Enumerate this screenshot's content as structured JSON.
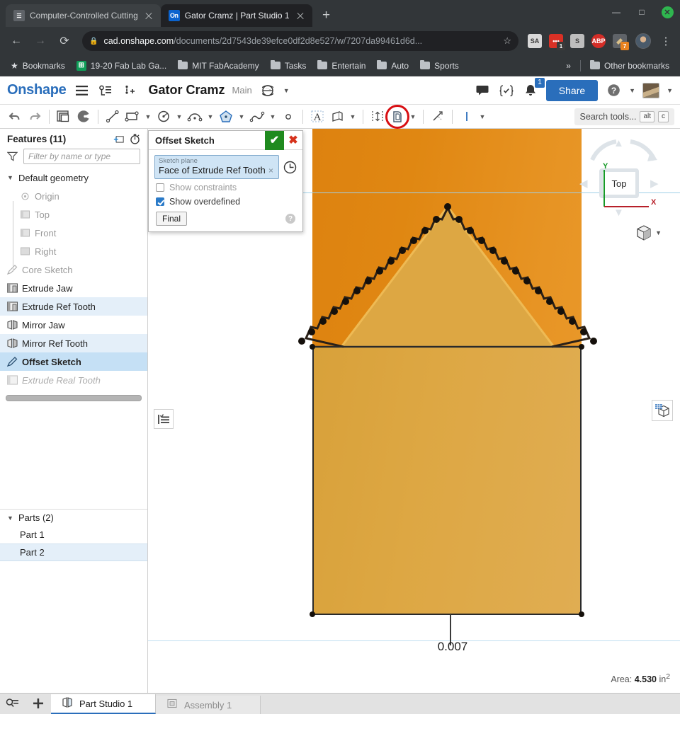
{
  "browser": {
    "tabs": [
      {
        "title": "Computer-Controlled Cutting",
        "favicon": "page-icon",
        "active": false
      },
      {
        "title": "Gator Cramz | Part Studio 1",
        "favicon": "onshape-icon",
        "active": true
      }
    ],
    "new_tab_label": "+",
    "window_controls": {
      "minimize": "—",
      "maximize": "□",
      "close": "✕"
    },
    "nav": {
      "back": "←",
      "forward": "→",
      "reload": "⟳"
    },
    "omnibox": {
      "lock_icon": "lock-icon",
      "host": "cad.onshape.com",
      "path": "/documents/2d7543de39efce0df2d8e527/w/7207da99461d6d...",
      "star_icon": "star-icon"
    },
    "extensions": [
      {
        "name": "SA",
        "label": "SA",
        "color": "#d8d8d8",
        "text_color": "#3a3a3a",
        "badge": ""
      },
      {
        "name": "red-dots",
        "label": "•••",
        "color": "#d93025",
        "text_color": "#ffffff",
        "badge": "1"
      },
      {
        "name": "S",
        "label": "S",
        "color": "#bdbdbd",
        "text_color": "#3a3a3a",
        "badge": ""
      },
      {
        "name": "ABP",
        "label": "ABP",
        "color": "#d42d27",
        "text_color": "#ffffff",
        "badge": ""
      },
      {
        "name": "honey",
        "label": "",
        "color": "#6b6b6b",
        "text_color": "#ffffff",
        "badge": "7"
      }
    ],
    "kebab_icon": "more-vertical-icon",
    "bookmarks": {
      "root_label": "Bookmarks",
      "items": [
        {
          "label": "19-20 Fab Lab Ga...",
          "icon": "google-sheets-icon"
        },
        {
          "label": "MIT FabAcademy",
          "icon": "folder-icon"
        },
        {
          "label": "Tasks",
          "icon": "folder-icon"
        },
        {
          "label": "Entertain",
          "icon": "folder-icon"
        },
        {
          "label": "Auto",
          "icon": "folder-icon"
        },
        {
          "label": "Sports",
          "icon": "folder-icon"
        }
      ],
      "overflow_label": "»",
      "other_label": "Other bookmarks"
    }
  },
  "onshape": {
    "logo": "Onshape",
    "document_title": "Gator Cramz",
    "branch": "Main",
    "header_icons": [
      "menu-icon",
      "version-graph-icon",
      "insert-feature-icon",
      "globe-icon"
    ],
    "right_icons": [
      "comment-icon",
      "checks-icon",
      "notification-bell-icon"
    ],
    "notification_count": "1",
    "share_label": "Share",
    "help_icon": "help-icon",
    "avatar": "user-avatar",
    "toolbar": {
      "items": [
        {
          "name": "undo-icon",
          "glyph": "↶"
        },
        {
          "name": "redo-icon",
          "glyph": "↷"
        },
        {
          "name": "new-sketch-icon",
          "glyph": ""
        },
        {
          "name": "shaded-view-icon",
          "glyph": ""
        },
        {
          "name": "line-tool-icon",
          "glyph": ""
        },
        {
          "name": "rectangle-tool-icon",
          "glyph": ""
        },
        {
          "name": "circle-tool-icon",
          "glyph": ""
        },
        {
          "name": "arc-tool-icon",
          "glyph": ""
        },
        {
          "name": "polygon-tool-icon",
          "glyph": ""
        },
        {
          "name": "spline-tool-icon",
          "glyph": ""
        },
        {
          "name": "point-tool-icon",
          "glyph": ""
        },
        {
          "name": "text-tool-icon",
          "glyph": ""
        },
        {
          "name": "mirror-tool-icon",
          "glyph": ""
        },
        {
          "name": "dimension-tool-icon",
          "glyph": ""
        },
        {
          "name": "offset-tool-icon",
          "glyph": ""
        },
        {
          "name": "trim-tool-icon",
          "glyph": ""
        },
        {
          "name": "construction-line-icon",
          "glyph": ""
        }
      ],
      "highlighted_tool": "offset-tool-icon",
      "search_placeholder": "Search tools...",
      "search_shortcut_1": "alt",
      "search_shortcut_2": "c"
    }
  },
  "features_panel": {
    "title": "Features (11)",
    "add_folder_icon": "add-folder-icon",
    "rollback_icon": "timer-icon",
    "filter_icon": "filter-icon",
    "filter_placeholder": "Filter by name or type",
    "items": [
      {
        "label": "Default geometry",
        "icon": "chevron-down-icon",
        "state": "group",
        "indent": 0
      },
      {
        "label": "Origin",
        "icon": "origin-icon",
        "state": "dim",
        "indent": 1
      },
      {
        "label": "Top",
        "icon": "plane-icon",
        "state": "dim",
        "indent": 1
      },
      {
        "label": "Front",
        "icon": "plane-icon",
        "state": "dim",
        "indent": 1
      },
      {
        "label": "Right",
        "icon": "plane-icon",
        "state": "dim",
        "indent": 1
      },
      {
        "label": "Core Sketch",
        "icon": "sketch-icon",
        "state": "dim",
        "indent": 0
      },
      {
        "label": "Extrude Jaw",
        "icon": "extrude-icon",
        "state": "normal",
        "indent": 0
      },
      {
        "label": "Extrude Ref Tooth",
        "icon": "extrude-icon",
        "state": "hl",
        "indent": 0
      },
      {
        "label": "Mirror Jaw",
        "icon": "mirror-icon",
        "state": "normal",
        "indent": 0
      },
      {
        "label": "Mirror Ref Tooth",
        "icon": "mirror-icon",
        "state": "hl",
        "indent": 0
      },
      {
        "label": "Offset Sketch",
        "icon": "sketch-icon",
        "state": "selected",
        "indent": 0
      },
      {
        "label": "Extrude Real Tooth",
        "icon": "extrude-icon",
        "state": "ghost",
        "indent": 0
      }
    ]
  },
  "parts_panel": {
    "title": "Parts (2)",
    "caret": "chevron-down-icon",
    "items": [
      {
        "label": "Part 1",
        "selected": false
      },
      {
        "label": "Part 2",
        "selected": true
      }
    ]
  },
  "offset_dialog": {
    "title": "Offset Sketch",
    "ok_icon": "check-icon",
    "cancel_icon": "close-icon",
    "sketch_plane_label": "Sketch plane",
    "sketch_plane_value": "Face of Extrude Ref Tooth",
    "sketch_plane_clear": "×",
    "history_icon": "sketch-history-icon",
    "show_constraints_label": "Show constraints",
    "show_constraints_checked": false,
    "show_overdefined_label": "Show overdefined",
    "show_overdefined_checked": true,
    "final_button_label": "Final",
    "help_label": "?"
  },
  "viewport": {
    "dimension_value": "0.007",
    "view_cube_face": "Top",
    "axis_x_label": "X",
    "axis_y_label": "Y",
    "area_label": "Area:",
    "area_value": "4.530",
    "area_units": "in",
    "area_exponent": "2",
    "list-view-icon": "sketch-list-icon",
    "display-icon": "display-mode-icon",
    "cube_dropdown_icon": "view-cube-dropdown-icon"
  },
  "bottom_bar": {
    "search_icon": "element-search-icon",
    "add_icon": "add-tab-icon",
    "tabs": [
      {
        "label": "Part Studio 1",
        "icon": "part-studio-icon",
        "active": true
      },
      {
        "label": "Assembly 1",
        "icon": "assembly-icon",
        "active": false
      }
    ]
  },
  "colors": {
    "accent": "#2a6ebb",
    "highlight_ring": "#d80f13",
    "ok_green": "#1f8a1f",
    "cancel_red": "#d6321c",
    "body_orange": "#e08712",
    "tooth_gold": "#dda743"
  }
}
